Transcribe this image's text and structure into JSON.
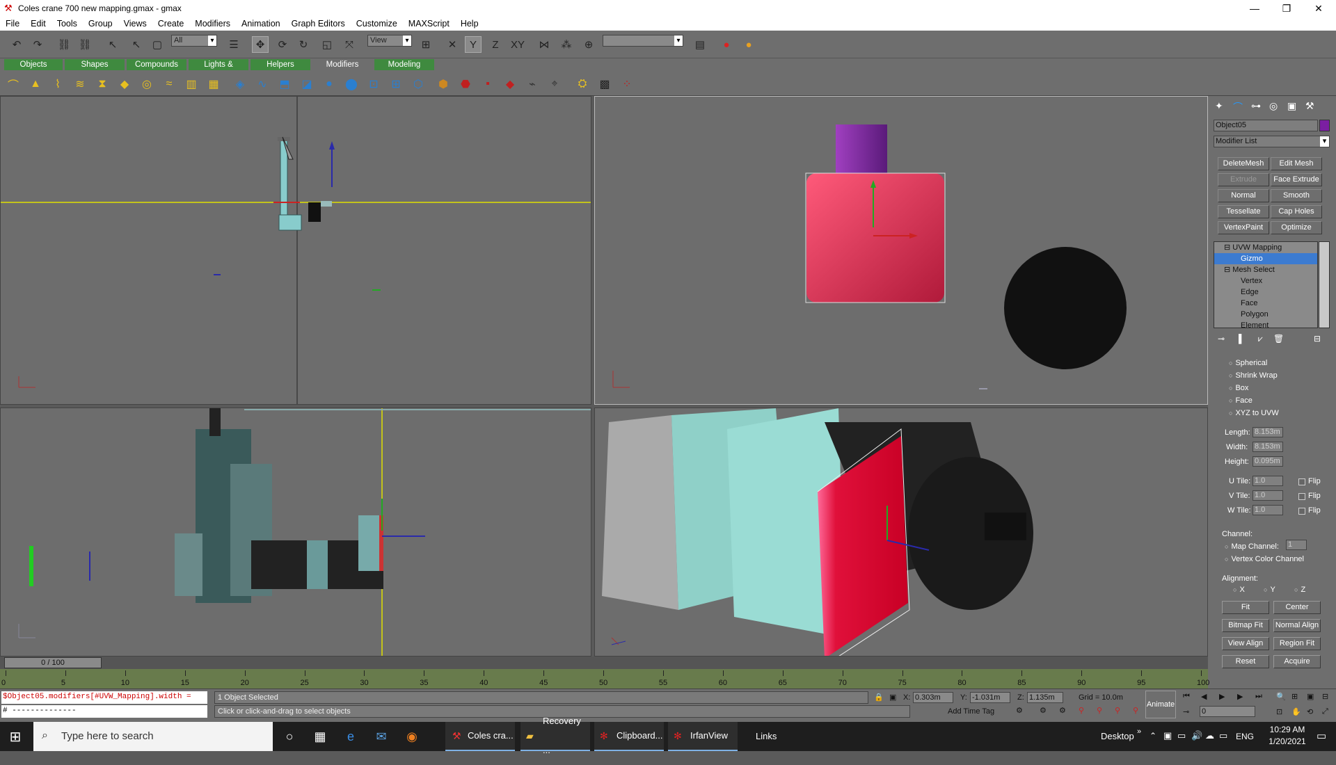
{
  "window": {
    "title": "Coles crane 700 new mapping.gmax - gmax",
    "min": "—",
    "restore": "❐",
    "close": "✕"
  },
  "menu": [
    "File",
    "Edit",
    "Tools",
    "Group",
    "Views",
    "Create",
    "Modifiers",
    "Animation",
    "Graph Editors",
    "Customize",
    "MAXScript",
    "Help"
  ],
  "toolbar": {
    "selection_filter": "All",
    "ref_coord": "View",
    "axis_x": "X",
    "axis_y": "Y",
    "axis_z": "Z",
    "axis_xy": "XY"
  },
  "tabs": [
    "Objects",
    "Shapes",
    "Compounds",
    "Lights & Cameras",
    "Helpers",
    "Modifiers",
    "Modeling"
  ],
  "active_tab": "Modifiers",
  "command_panel": {
    "object_name": "Object05",
    "object_color": "#7b1fa2",
    "modifier_list": "Modifier List",
    "modifier_buttons": [
      {
        "label": "DeleteMesh",
        "enabled": true
      },
      {
        "label": "Edit Mesh",
        "enabled": true
      },
      {
        "label": "Extrude",
        "enabled": false
      },
      {
        "label": "Face Extrude",
        "enabled": true
      },
      {
        "label": "Normal",
        "enabled": true
      },
      {
        "label": "Smooth",
        "enabled": true
      },
      {
        "label": "Tessellate",
        "enabled": true
      },
      {
        "label": "Cap Holes",
        "enabled": true
      },
      {
        "label": "VertexPaint",
        "enabled": true
      },
      {
        "label": "Optimize",
        "enabled": true
      }
    ],
    "stack": [
      {
        "label": "UVW Mapping",
        "level": 0,
        "selected": false
      },
      {
        "label": "Gizmo",
        "level": 1,
        "selected": true
      },
      {
        "label": "Mesh Select",
        "level": 0,
        "selected": false
      },
      {
        "label": "Vertex",
        "level": 1,
        "selected": false
      },
      {
        "label": "Edge",
        "level": 1,
        "selected": false
      },
      {
        "label": "Face",
        "level": 1,
        "selected": false
      },
      {
        "label": "Polygon",
        "level": 1,
        "selected": false
      },
      {
        "label": "Element",
        "level": 1,
        "selected": false
      }
    ],
    "mapping_types": [
      "Spherical",
      "Shrink Wrap",
      "Box",
      "Face",
      "XYZ to UVW"
    ],
    "params": {
      "length_label": "Length:",
      "length": "8.153m",
      "width_label": "Width:",
      "width": "8.153m",
      "height_label": "Height:",
      "height": "0.095m",
      "utile_label": "U Tile:",
      "utile": "1.0",
      "vtile_label": "V Tile:",
      "vtile": "1.0",
      "wtile_label": "W Tile:",
      "wtile": "1.0",
      "flip": "Flip"
    },
    "channel": {
      "title": "Channel:",
      "map_channel": "Map Channel:",
      "map_channel_value": "1",
      "vertex_color": "Vertex Color Channel"
    },
    "alignment": {
      "title": "Alignment:",
      "x": "X",
      "y": "Y",
      "z": "Z",
      "buttons": [
        "Fit",
        "Center",
        "Bitmap Fit",
        "Normal Align",
        "View Align",
        "Region Fit",
        "Reset",
        "Acquire"
      ]
    }
  },
  "timeline": {
    "frame": "0 / 100",
    "ticks": [
      "0",
      "5",
      "10",
      "15",
      "20",
      "25",
      "30",
      "35",
      "40",
      "45",
      "50",
      "55",
      "60",
      "65",
      "70",
      "75",
      "80",
      "85",
      "90",
      "95",
      "100"
    ]
  },
  "status": {
    "script_line1": "$Object05.modifiers[#UVW_Mapping].width =",
    "script_line2": "# --------------",
    "selected": "1 Object Selected",
    "prompt": "Click or click-and-drag to select objects",
    "x_label": "X:",
    "x": "0.303m",
    "y_label": "Y:",
    "y": "-1.031m",
    "z_label": "Z:",
    "z": "1.135m",
    "grid": "Grid = 10.0m",
    "time_tag": "Add Time Tag",
    "animate": "Animate",
    "frame_field": "0"
  },
  "taskbar": {
    "search_placeholder": "Type here to search",
    "apps": [
      "Coles cra...",
      "Recovery ...",
      "Clipboard...",
      "IrfanView"
    ],
    "links": "Links",
    "desktop": "Desktop",
    "lang": "ENG",
    "time": "10:29 AM",
    "date": "1/20/2021"
  }
}
